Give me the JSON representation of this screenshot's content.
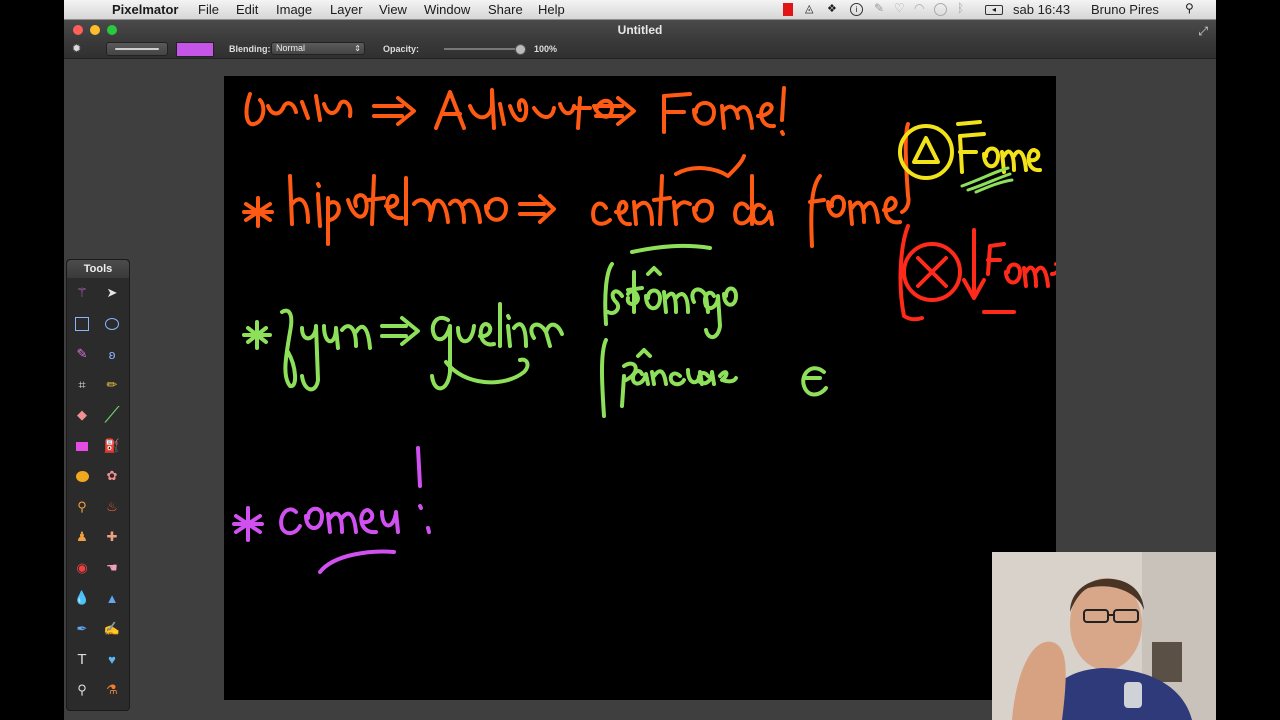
{
  "menubar": {
    "app_name": "Pixelmator",
    "items": [
      "File",
      "Edit",
      "Image",
      "Layer",
      "View",
      "Window",
      "Share",
      "Help"
    ],
    "clock": "sab 16:43",
    "user": "Bruno Pires"
  },
  "window": {
    "title": "Untitled"
  },
  "toolbar": {
    "blending_label": "Blending:",
    "blending_value": "Normal",
    "opacity_label": "Opacity:",
    "opacity_value": "100%",
    "opacity_fraction": 1.0,
    "brush_color": "#c455e6"
  },
  "tools_panel": {
    "title": "Tools",
    "icons": [
      "magic-wand-icon",
      "arrow-icon",
      "rect-select-icon",
      "ellipse-select-icon",
      "paintbrush-select-icon",
      "lasso-icon",
      "crop-icon",
      "pencil-icon",
      "eraser-icon",
      "brush-icon",
      "rectangle-shape-icon",
      "paint-bucket-icon",
      "ellipse-shape-icon",
      "color-picker-icon",
      "dodge-icon",
      "burn-icon",
      "stamp-icon",
      "heal-icon",
      "redeye-icon",
      "smudge-icon",
      "blur-icon",
      "sharpen-icon",
      "pen-icon",
      "freeform-pen-icon",
      "type-icon",
      "shape-icon",
      "zoom-icon",
      "eyedropper-icon"
    ]
  },
  "colors": {
    "orange_ink": "#ff5a14",
    "green_ink": "#8ee05a",
    "magenta_ink": "#d050f0",
    "yellow_ink": "#f2e21a",
    "red_ink": "#ff2a1a"
  }
}
